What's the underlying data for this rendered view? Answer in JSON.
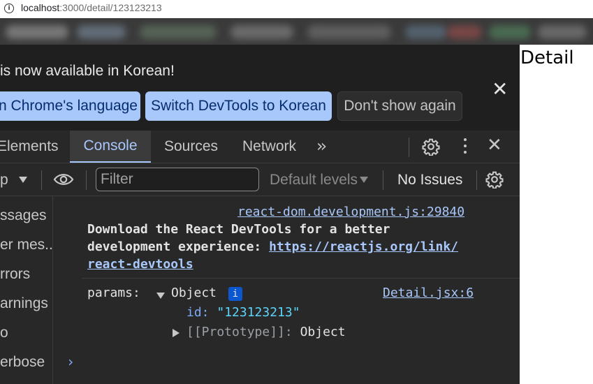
{
  "browser": {
    "url_host": "localhost",
    "url_path": ":3000/detail/123123213",
    "info_icon": "info-icon"
  },
  "page": {
    "heading": "Detail"
  },
  "devtools": {
    "language_bar": {
      "message": "is now available in Korean!",
      "buttons": [
        "n Chrome's language",
        "Switch DevTools to Korean",
        "Don't show again"
      ],
      "close_icon": "close-icon"
    },
    "tabs": [
      {
        "label": "Elements",
        "active": false
      },
      {
        "label": "Console",
        "active": true
      },
      {
        "label": "Sources",
        "active": false
      },
      {
        "label": "Network",
        "active": false
      }
    ],
    "more_tabs_icon": "double-chevron-icon",
    "toolbar": {
      "context_label": "p",
      "filter_placeholder": "Filter",
      "levels_label": "Default levels",
      "issues_label": "No Issues"
    },
    "sidebar_items": [
      "ssages",
      "er mes...",
      "rrors",
      "arnings",
      "o",
      "erbose"
    ],
    "console": {
      "messages": [
        {
          "source": "react-dom.development.js:29840",
          "line1": "Download the React DevTools for a better",
          "line2": "development experience: ",
          "link_part1": "https://reactjs.org/link/",
          "link_part2": "react-devtools"
        },
        {
          "label": "params:",
          "object_label": "Object",
          "info_badge": "i",
          "source": "Detail.jsx:6",
          "prop_key": "id:",
          "prop_value": "\"123123213\"",
          "proto_key": "[[Prototype]]:",
          "proto_value": "Object"
        }
      ],
      "prompt": "›"
    },
    "colors": {
      "accent": "#a8c7fa",
      "panel_bg": "#282828",
      "string_value": "#5cd5fb",
      "key_color": "#7cacf8"
    }
  }
}
